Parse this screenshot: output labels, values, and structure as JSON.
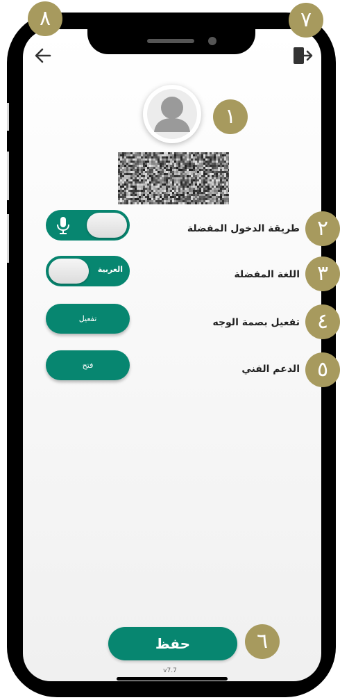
{
  "profile": {
    "avatar_icon": "user-avatar-placeholder",
    "qr_icon": "qr-code"
  },
  "header": {
    "back_icon": "arrow-left-icon",
    "logout_icon": "logout-icon"
  },
  "settings": {
    "login_method_label": "طريقة الدخول المفضلة",
    "language_label": "اللغة المفضلة",
    "language_value": "العربية",
    "face_id_label": "تفعيل بصمة الوجه",
    "face_id_button": "تفعيل",
    "support_label": "الدعم الفني",
    "support_button": "فتح"
  },
  "footer": {
    "save_label": "حفظ",
    "version": "v7.7"
  },
  "badges": {
    "b1": "١",
    "b2": "٢",
    "b3": "٣",
    "b4": "٤",
    "b5": "٥",
    "b6": "٦",
    "b7": "٧",
    "b8": "٨"
  },
  "colors": {
    "primary": "#078670",
    "badge": "#a79a5e"
  }
}
